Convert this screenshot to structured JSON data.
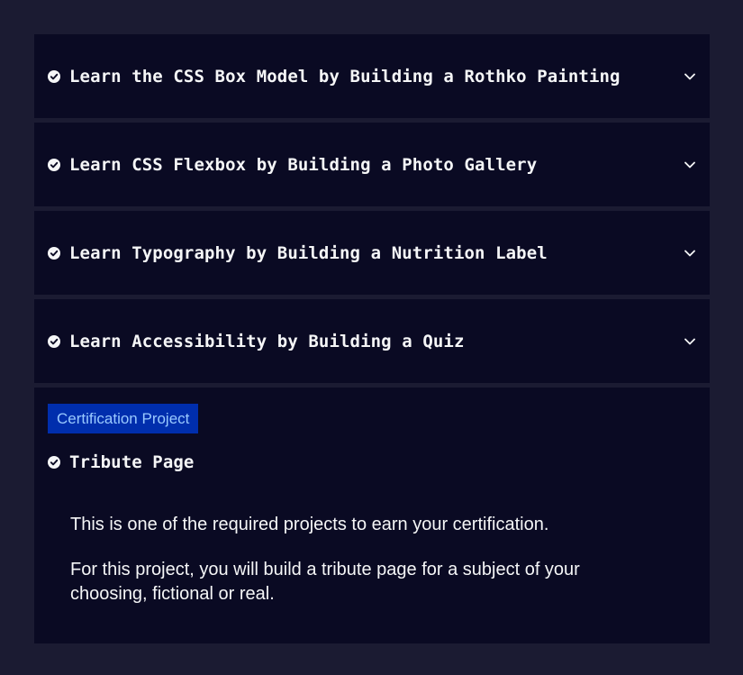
{
  "sections": [
    {
      "title": "Learn the CSS Box Model by Building a Rothko Painting",
      "icon": "check-circle-icon",
      "expand_icon": "chevron-down-icon"
    },
    {
      "title": "Learn CSS Flexbox by Building a Photo Gallery",
      "icon": "check-circle-icon",
      "expand_icon": "chevron-down-icon"
    },
    {
      "title": "Learn Typography by Building a Nutrition Label",
      "icon": "check-circle-icon",
      "expand_icon": "chevron-down-icon"
    },
    {
      "title": "Learn Accessibility by Building a Quiz",
      "icon": "check-circle-icon",
      "expand_icon": "chevron-down-icon"
    }
  ],
  "certification": {
    "badge": "Certification Project",
    "project_title": "Tribute Page",
    "icon": "check-circle-icon",
    "description_1": "This is one of the required projects to earn your certification.",
    "description_2": "For this project, you will build a tribute page for a subject of your choosing, fictional or real."
  },
  "colors": {
    "page_bg": "#1b1b32",
    "block_bg": "#0a0a23",
    "text": "#f5f6f7",
    "badge_bg": "#002ead",
    "badge_text": "#99c9ff"
  }
}
